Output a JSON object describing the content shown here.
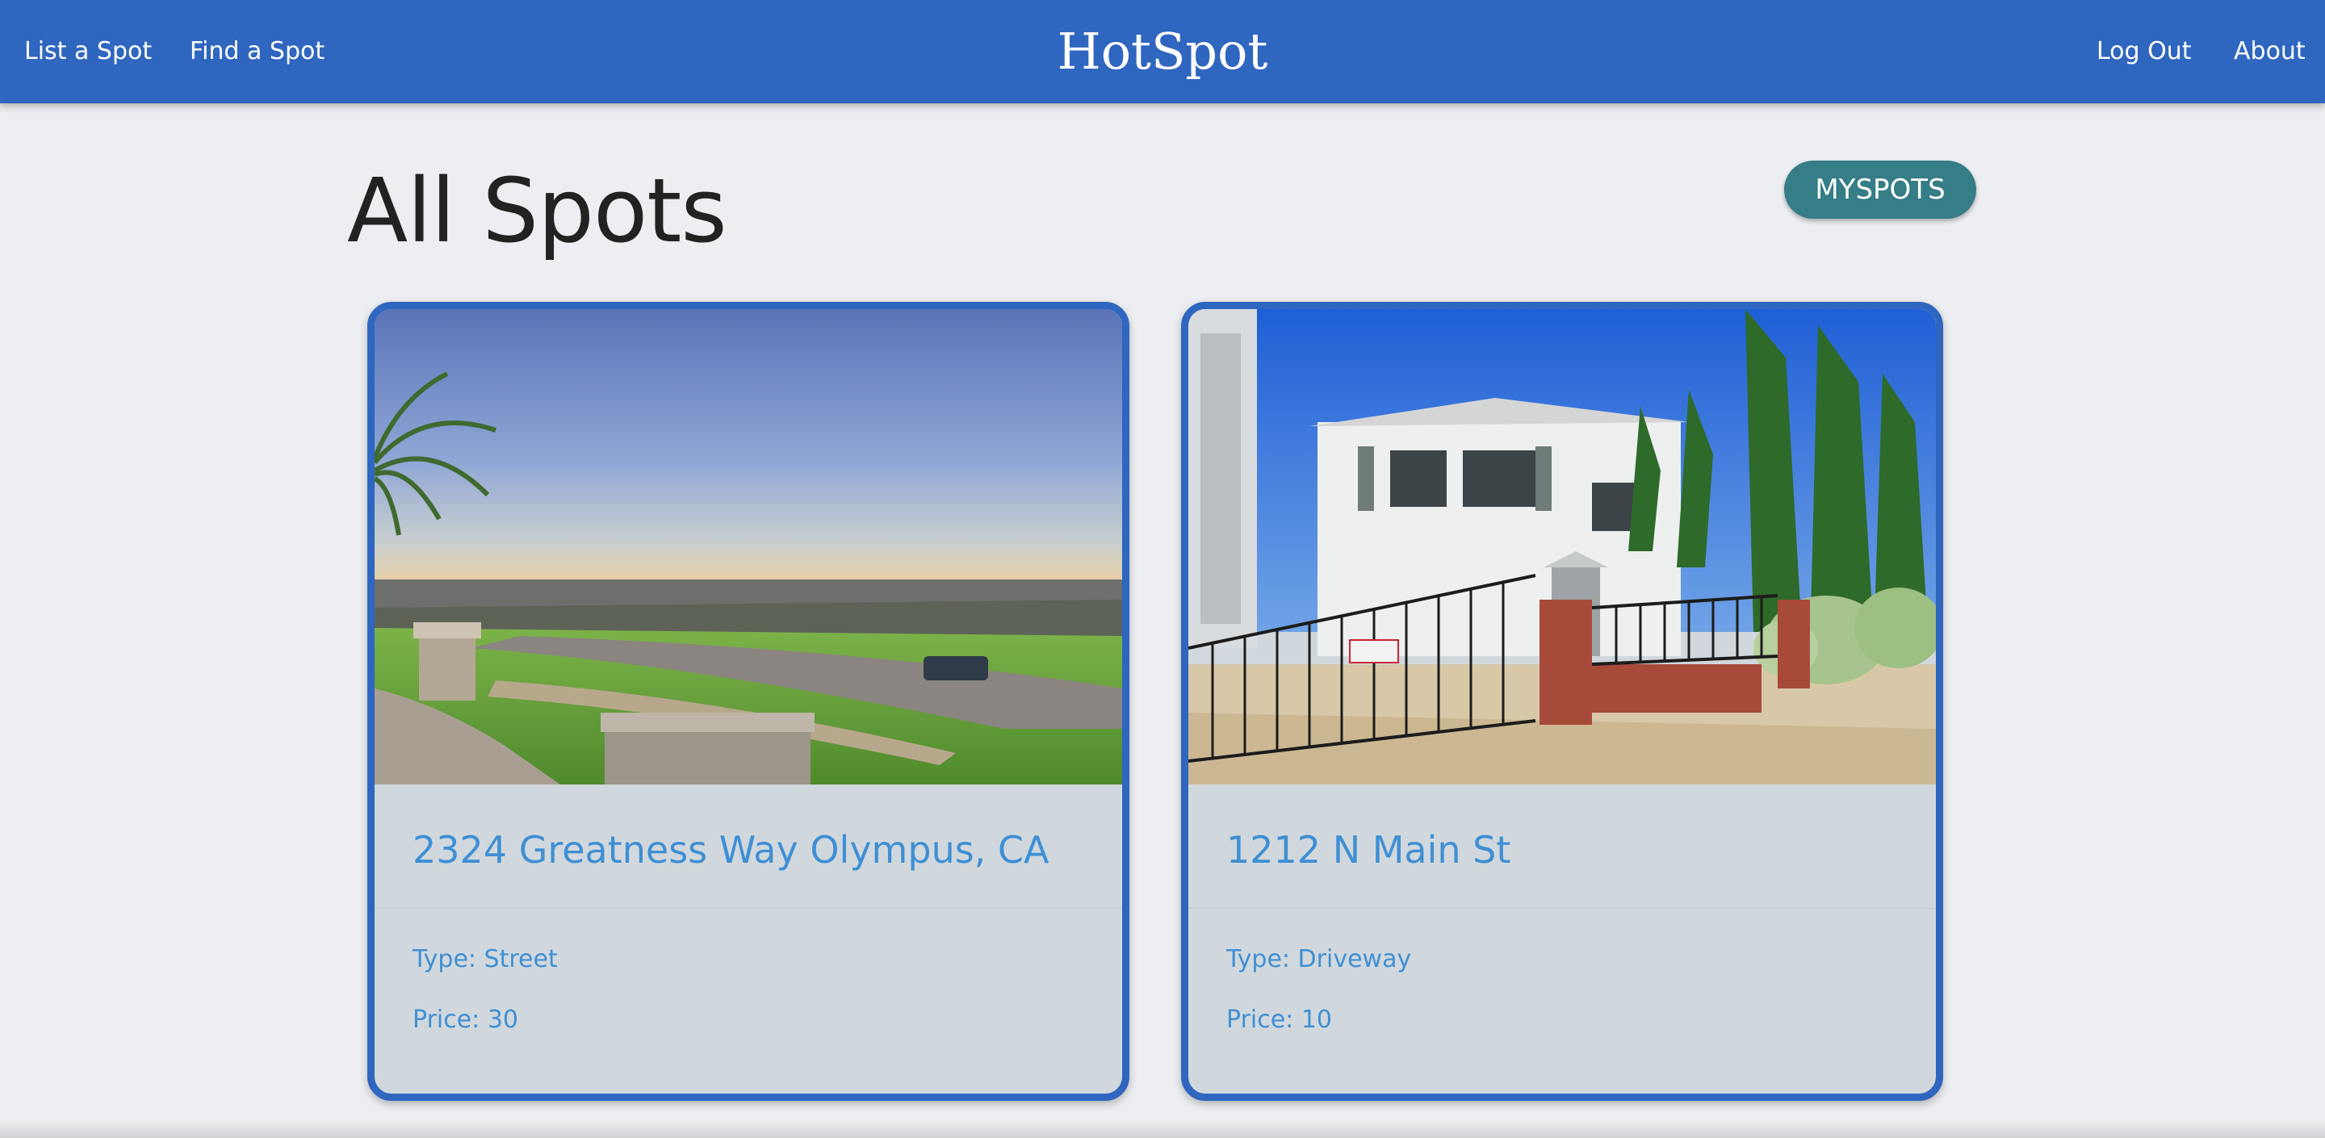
{
  "nav": {
    "left_links": [
      "List a Spot",
      "Find a Spot"
    ],
    "brand": "HotSpot",
    "right_links": [
      "Log Out",
      "About"
    ]
  },
  "page": {
    "title": "All Spots",
    "myspots_label": "MYSPOTS"
  },
  "spots": [
    {
      "address": "2324 Greatness Way Olympus, CA",
      "type_text": "Type: Street",
      "price_text": "Price: 30",
      "image_subject": "hillside-ocean-view-photo"
    },
    {
      "address": "1212 N Main St",
      "type_text": "Type: Driveway",
      "price_text": "Price: 10",
      "image_subject": "white-house-driveway-gate-photo"
    }
  ],
  "colors": {
    "navbar": "#2f66bf",
    "background": "#eceef1",
    "myspots_button": "#357d87",
    "card_border": "#2f66bf",
    "card_body": "#d1d8dd",
    "card_text": "#3f8fd4"
  }
}
